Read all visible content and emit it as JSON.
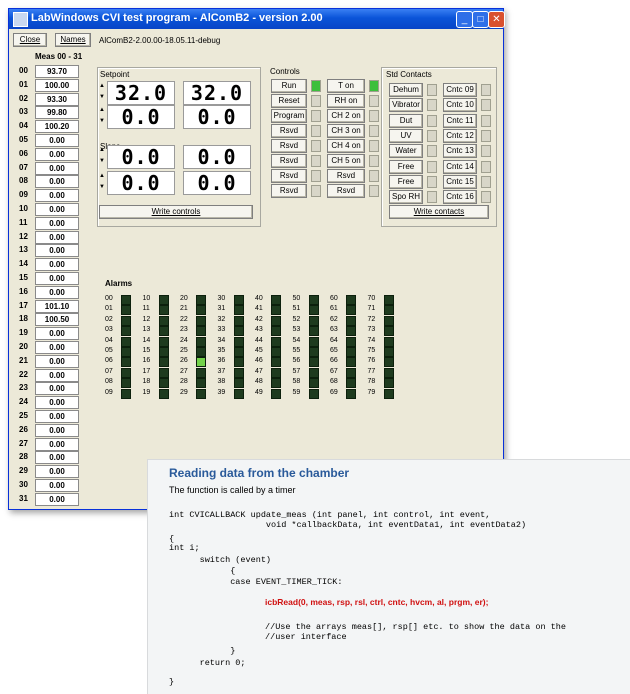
{
  "window": {
    "title": "LabWindows CVI test program - AlComB2 - version 2.00",
    "buttons": {
      "close": "Close",
      "names": "Names"
    },
    "build_label": "AlComB2-2.00.00-18.05.11-debug"
  },
  "meas": {
    "title": "Meas 00 - 31",
    "rows": [
      {
        "idx": "00",
        "val": "93.70"
      },
      {
        "idx": "01",
        "val": "100.00"
      },
      {
        "idx": "02",
        "val": "93.30"
      },
      {
        "idx": "03",
        "val": "99.80"
      },
      {
        "idx": "04",
        "val": "100.20"
      },
      {
        "idx": "05",
        "val": "0.00"
      },
      {
        "idx": "06",
        "val": "0.00"
      },
      {
        "idx": "07",
        "val": "0.00"
      },
      {
        "idx": "08",
        "val": "0.00"
      },
      {
        "idx": "09",
        "val": "0.00"
      },
      {
        "idx": "10",
        "val": "0.00"
      },
      {
        "idx": "11",
        "val": "0.00"
      },
      {
        "idx": "12",
        "val": "0.00"
      },
      {
        "idx": "13",
        "val": "0.00"
      },
      {
        "idx": "14",
        "val": "0.00"
      },
      {
        "idx": "15",
        "val": "0.00"
      },
      {
        "idx": "16",
        "val": "0.00"
      },
      {
        "idx": "17",
        "val": "101.10"
      },
      {
        "idx": "18",
        "val": "100.50"
      },
      {
        "idx": "19",
        "val": "0.00"
      },
      {
        "idx": "20",
        "val": "0.00"
      },
      {
        "idx": "21",
        "val": "0.00"
      },
      {
        "idx": "22",
        "val": "0.00"
      },
      {
        "idx": "23",
        "val": "0.00"
      },
      {
        "idx": "24",
        "val": "0.00"
      },
      {
        "idx": "25",
        "val": "0.00"
      },
      {
        "idx": "26",
        "val": "0.00"
      },
      {
        "idx": "27",
        "val": "0.00"
      },
      {
        "idx": "28",
        "val": "0.00"
      },
      {
        "idx": "29",
        "val": "0.00"
      },
      {
        "idx": "30",
        "val": "0.00"
      },
      {
        "idx": "31",
        "val": "0.00"
      }
    ]
  },
  "setpoint": {
    "label": "Setpoint",
    "values": [
      "32.0",
      "32.0",
      "0.0",
      "0.0"
    ]
  },
  "slope": {
    "label": "Slope",
    "values": [
      "0.0",
      "0.0",
      "0.0",
      "0.0"
    ]
  },
  "write_controls": "Write controls",
  "controls": {
    "label": "Controls",
    "left": [
      {
        "label": "Run",
        "led": true
      },
      {
        "label": "Reset",
        "led": false
      },
      {
        "label": "Program",
        "led": false
      },
      {
        "label": "Rsvd",
        "led": false
      },
      {
        "label": "Rsvd",
        "led": false
      },
      {
        "label": "Rsvd",
        "led": false
      },
      {
        "label": "Rsvd",
        "led": false
      },
      {
        "label": "Rsvd",
        "led": false
      }
    ],
    "right": [
      {
        "label": "T on",
        "led": true
      },
      {
        "label": "RH on",
        "led": false
      },
      {
        "label": "CH 2 on",
        "led": false
      },
      {
        "label": "CH 3 on",
        "led": false
      },
      {
        "label": "CH 4 on",
        "led": false
      },
      {
        "label": "CH 5 on",
        "led": false
      },
      {
        "label": "Rsvd",
        "led": false
      },
      {
        "label": "Rsvd",
        "led": false
      }
    ]
  },
  "std_contacts": {
    "label": "Std Contacts",
    "left": [
      "Dehum",
      "Vibrator",
      "Dut",
      "UV",
      "Water",
      "Free",
      "Free",
      "Spo RH"
    ],
    "right": [
      "Cntc 09",
      "Cntc 10",
      "Cntc 11",
      "Cntc 12",
      "Cntc 13",
      "Cntc 14",
      "Cntc 15",
      "Cntc 16"
    ],
    "write": "Write contacts"
  },
  "alarms": {
    "label": "Alarms",
    "active": [
      "26"
    ]
  },
  "code": {
    "heading": "Reading data from the chamber",
    "sub": "The function is called by a timer",
    "lines": [
      "int CVICALLBACK update_meas (int panel, int control, int event,",
      "                   void *callbackData, int eventData1, int eventData2)",
      "{",
      "int i;",
      "      switch (event)",
      "            {",
      "            case EVENT_TIMER_TICK:",
      "icbRead(0, meas, rsp, rsl, ctrl, cntc, hvcm, al, prgm, er);",
      "//Use the arrays meas[], rsp[] etc. to show the data on the",
      "//user interface",
      "            }",
      "      return 0;",
      "}"
    ]
  }
}
